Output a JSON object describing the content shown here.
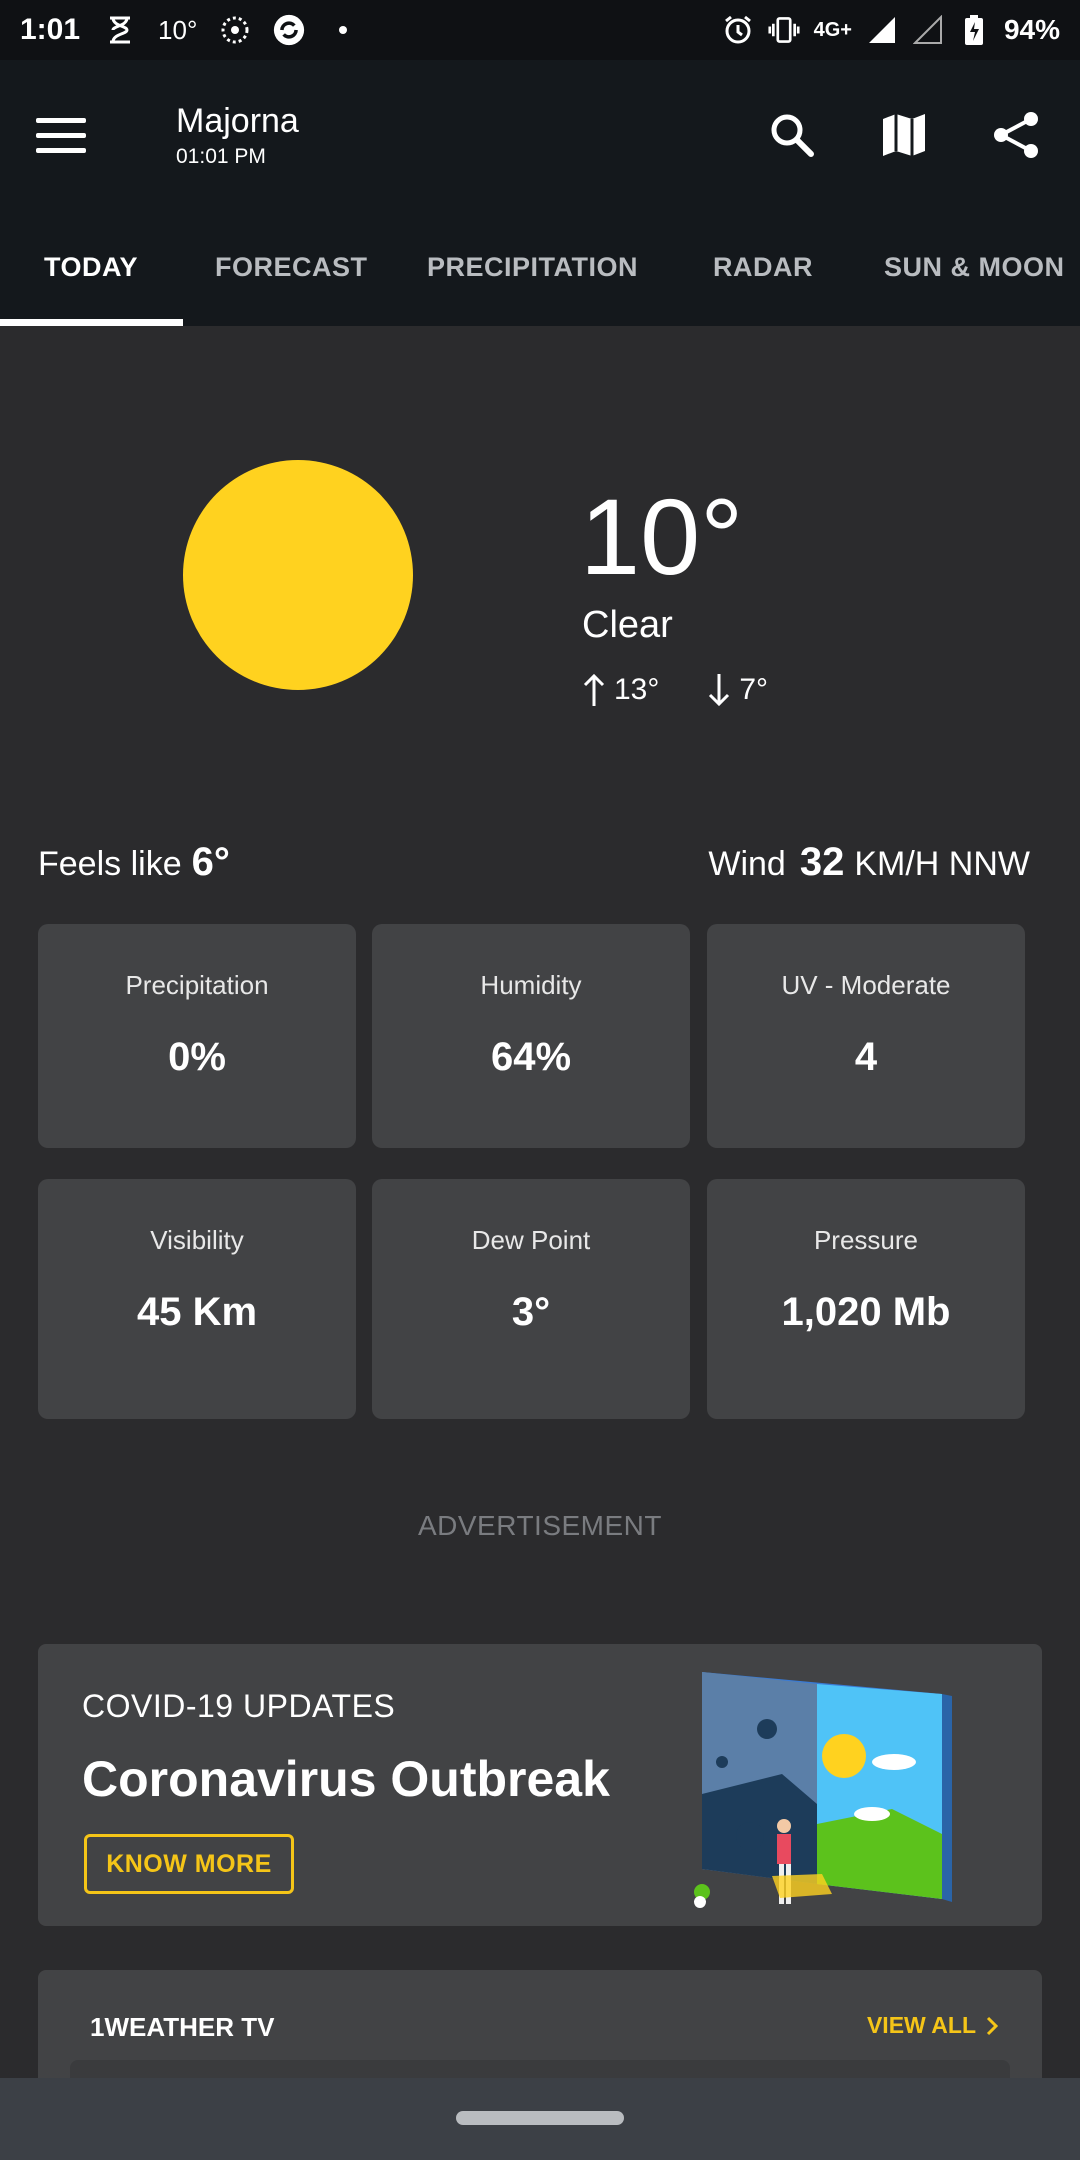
{
  "status_bar": {
    "time": "1:01",
    "temp": "10°",
    "network": "4G+",
    "battery": "94%",
    "icons": [
      "hourglass-icon",
      "temperature-text",
      "dotted-circle-icon",
      "refresh-app-icon",
      "dot-icon",
      "alarm-icon",
      "vibrate-icon",
      "signal-icon",
      "signal-empty-icon",
      "battery-charging-icon"
    ]
  },
  "app_bar": {
    "location": "Majorna",
    "time": "01:01 PM",
    "actions": [
      "search-icon",
      "map-icon",
      "share-icon"
    ]
  },
  "tabs": [
    {
      "label": "TODAY",
      "active": true
    },
    {
      "label": "FORECAST",
      "active": false
    },
    {
      "label": "PRECIPITATION",
      "active": false
    },
    {
      "label": "RADAR",
      "active": false
    },
    {
      "label": "SUN & MOON",
      "active": false
    }
  ],
  "current": {
    "temperature": "10°",
    "condition": "Clear",
    "high": "13°",
    "low": "7°",
    "feels_like_label": "Feels like",
    "feels_like": "6°",
    "wind_label": "Wind",
    "wind_speed": "32",
    "wind_unit": "KM/H NNW"
  },
  "details": [
    {
      "label": "Precipitation",
      "value": "0%"
    },
    {
      "label": "Humidity",
      "value": "64%"
    },
    {
      "label": "UV - Moderate",
      "value": "4"
    },
    {
      "label": "Visibility",
      "value": "45 Km"
    },
    {
      "label": "Dew Point",
      "value": "3°"
    },
    {
      "label": "Pressure",
      "value": "1,020 Mb"
    }
  ],
  "advertisement_label": "ADVERTISEMENT",
  "covid": {
    "kicker": "COVID-19 UPDATES",
    "headline": "Coronavirus Outbreak",
    "button": "KNOW MORE"
  },
  "weather_tv": {
    "title": "1WEATHER TV",
    "view_all": "VIEW ALL"
  },
  "colors": {
    "background": "#2b2b2d",
    "appbar": "#14181c",
    "card": "#424345",
    "sun": "#ffd21f",
    "accent": "#f5c518"
  }
}
